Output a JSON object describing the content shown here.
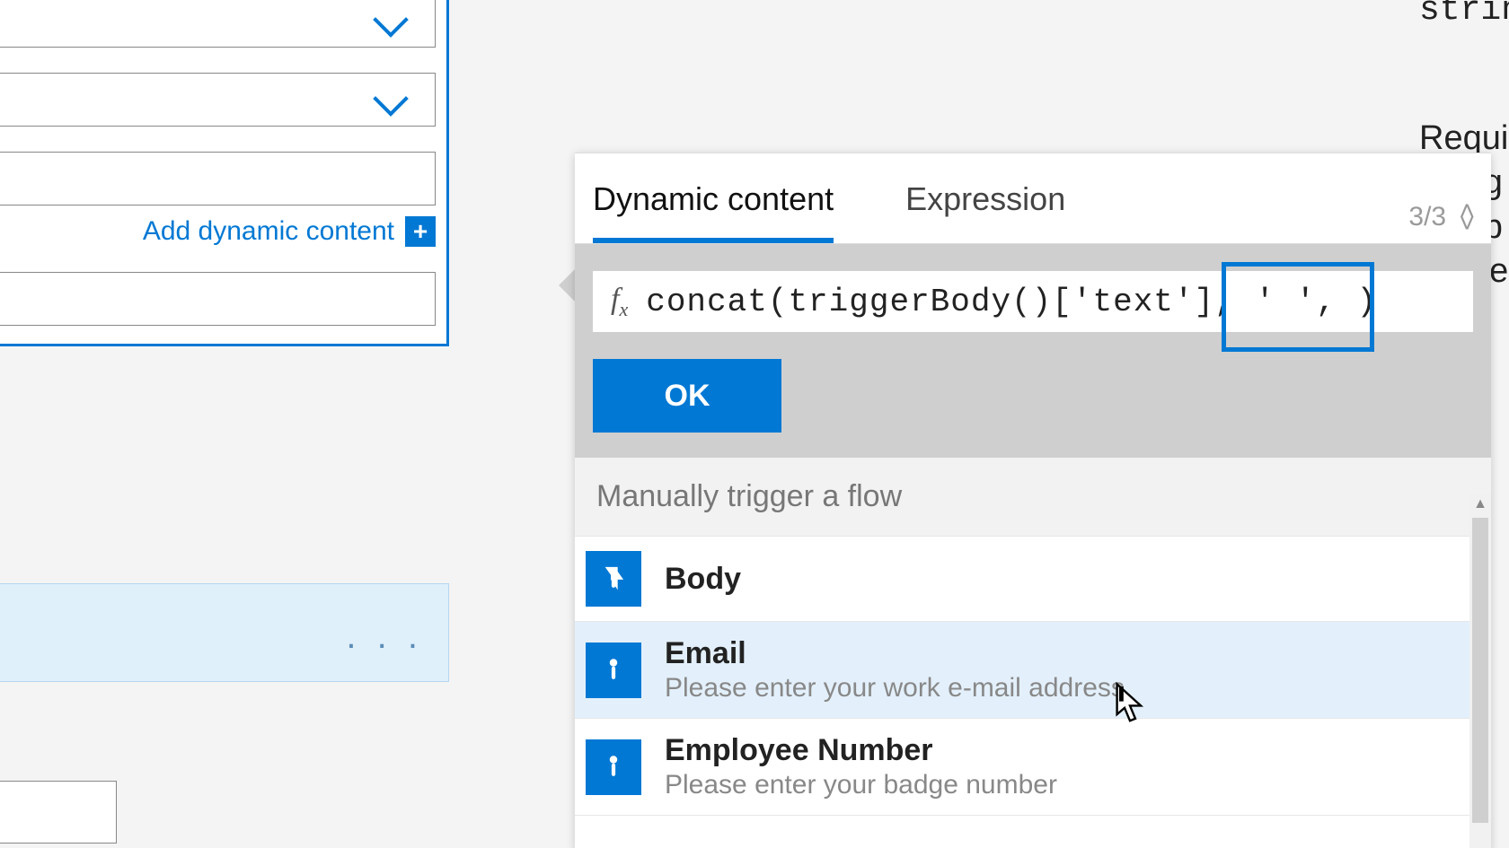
{
  "left": {
    "add_dynamic_label": "Add dynamic content"
  },
  "panel": {
    "tabs": {
      "dynamic": "Dynamic content",
      "expression": "Expression"
    },
    "count": "3/3",
    "expression_value": "concat(triggerBody()['text'], ' ', )",
    "ok_label": "OK",
    "section_header": "Manually trigger a flow",
    "items": [
      {
        "title": "Body",
        "desc": ""
      },
      {
        "title": "Email",
        "desc": "Please enter your work e-mail address"
      },
      {
        "title": "Employee Number",
        "desc": "Please enter your badge number"
      }
    ]
  },
  "tooltip": {
    "line0": "strin",
    "line1": "Requi",
    "line2": "string",
    "line3": "comb",
    "line4": "single"
  }
}
